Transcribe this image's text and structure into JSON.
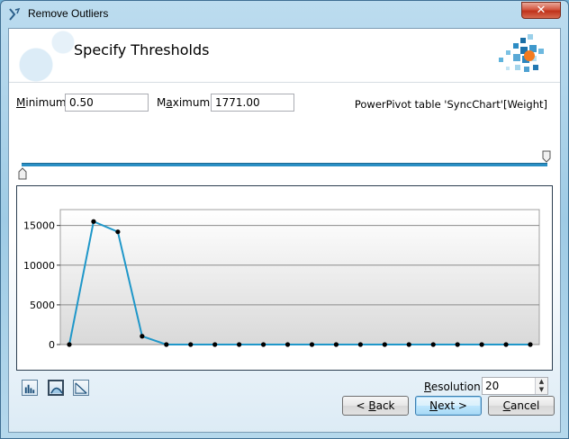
{
  "window": {
    "title": "Remove Outliers",
    "close_glyph": "✕"
  },
  "header": {
    "title": "Specify Thresholds"
  },
  "filters": {
    "min_label_mnemonic": "M",
    "min_label_rest": "inimum:",
    "min_value": "0.50",
    "max_label_pre": "M",
    "max_label_mnemonic": "a",
    "max_label_rest": "ximum:",
    "max_value": "1771.00",
    "source": "PowerPivot table 'SyncChart'[Weight]"
  },
  "slider": {
    "min_fraction": 0.0,
    "max_fraction": 1.0
  },
  "chart_data": {
    "type": "line",
    "x": [
      1,
      2,
      3,
      4,
      5,
      6,
      7,
      8,
      9,
      10,
      11,
      12,
      13,
      14,
      15,
      16,
      17,
      18,
      19,
      20
    ],
    "series": [
      {
        "values": [
          0,
          15500,
          14200,
          1050,
          0,
          0,
          0,
          0,
          0,
          0,
          0,
          0,
          0,
          0,
          0,
          0,
          0,
          0,
          0,
          0
        ]
      }
    ],
    "ylim": [
      0,
      17000
    ],
    "yticks": [
      0,
      5000,
      10000,
      15000
    ],
    "ytick_labels": [
      "0",
      "5000",
      "10000",
      "15000"
    ],
    "grid": true,
    "line_color": "#1f97c9",
    "marker_color": "#000000"
  },
  "toolbar": {
    "buttons": [
      {
        "name": "histogram-view-icon",
        "active": false
      },
      {
        "name": "curve-view-icon",
        "active": true
      },
      {
        "name": "cumulative-view-icon",
        "active": false
      }
    ]
  },
  "resolution": {
    "label_mnemonic": "R",
    "label_rest": "esolution:",
    "value": "20"
  },
  "footer": {
    "back_prefix": "< ",
    "back_mnemonic": "B",
    "back_rest": "ack",
    "next_mnemonic": "N",
    "next_rest": "ext >",
    "cancel_mnemonic": "C",
    "cancel_rest": "ancel"
  }
}
